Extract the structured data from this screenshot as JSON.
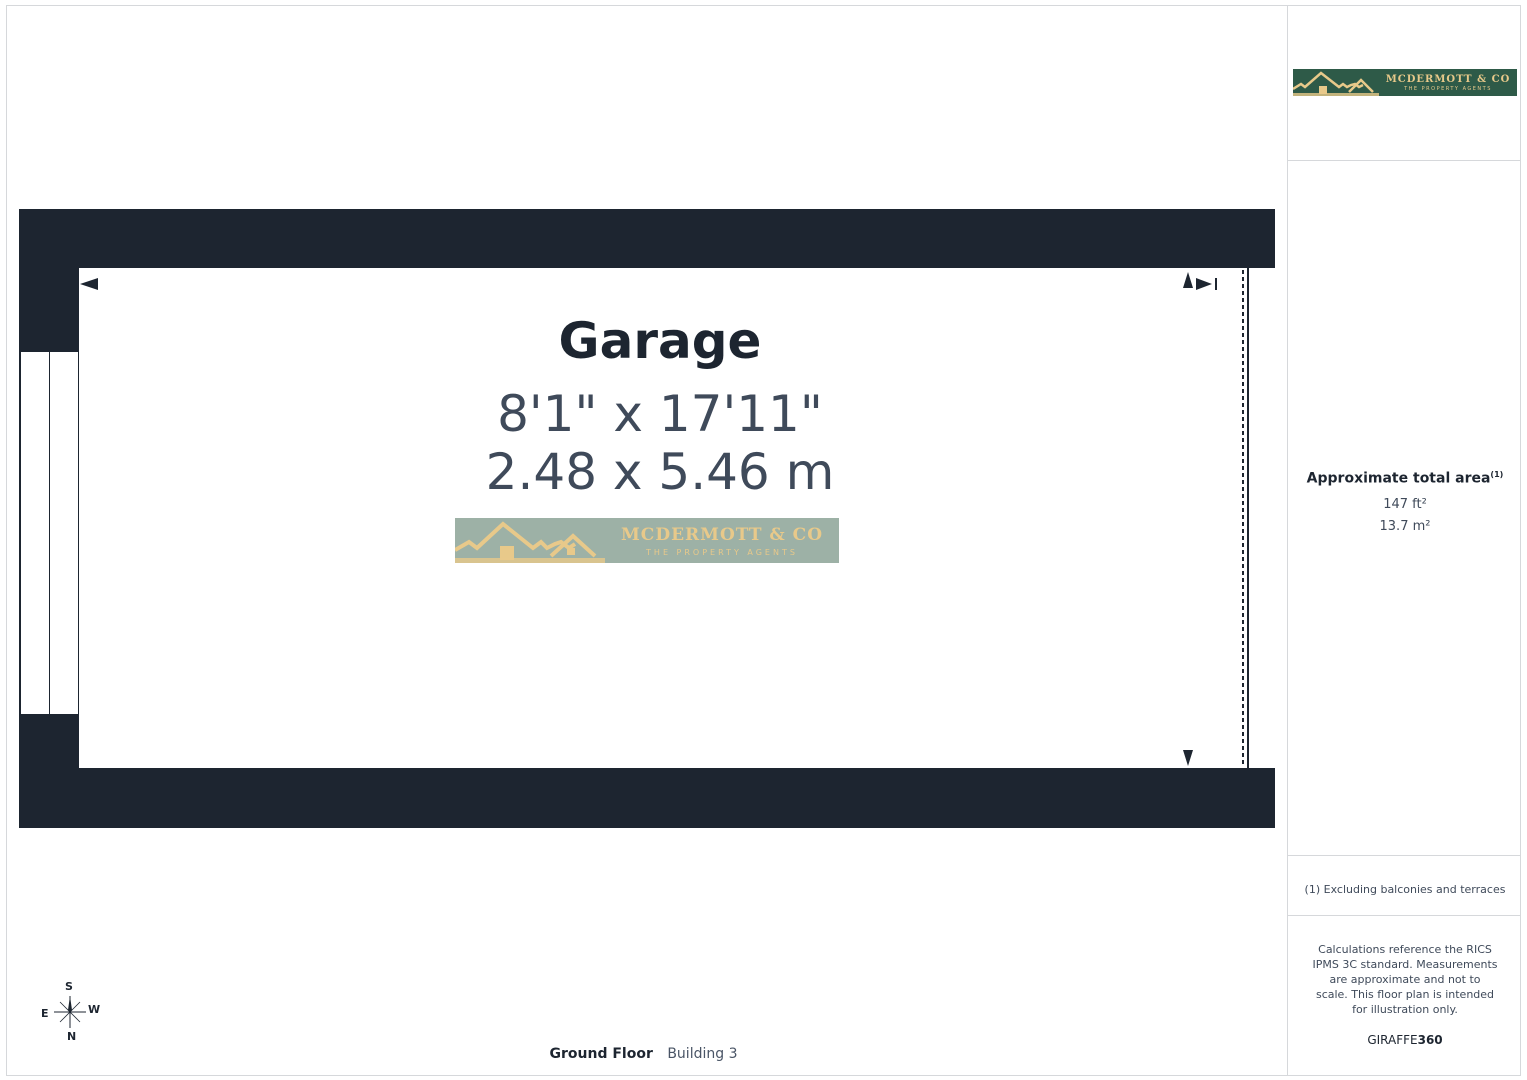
{
  "plan": {
    "room_name": "Garage",
    "dim_imperial": "8'1\" x 17'11\"",
    "dim_metric": "2.48 x 5.46 m",
    "floor_label": "Ground Floor",
    "building_label": "Building 3"
  },
  "brand": {
    "name": "MCDERMOTT & CO",
    "tagline": "THE PROPERTY AGENTS",
    "sidebar_bg": "#2e5a48",
    "plan_bg": "#9db1a6",
    "gold": "#e8c98a"
  },
  "summary": {
    "title": "Approximate total area",
    "title_note": "(1)",
    "area_ft": "147 ft²",
    "area_m": "13.7 m²",
    "footnote": "(1) Excluding balconies and terraces",
    "disclaimer": "Calculations reference the RICS IPMS 3C standard. Measurements are approximate and not to scale. This floor plan is intended for illustration only.",
    "provider_prefix": "GIRAFFE",
    "provider_suffix": "360"
  },
  "compass": {
    "n": "N",
    "s": "S",
    "e": "E",
    "w": "W"
  },
  "colors": {
    "wall": "#1d2530",
    "text_secondary": "#3f4a5a"
  }
}
